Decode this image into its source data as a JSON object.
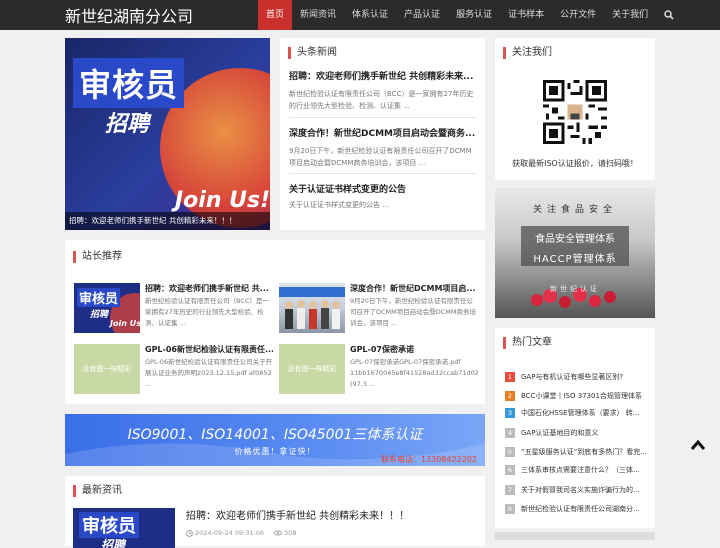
{
  "site": {
    "title": "新世纪湖南分公司"
  },
  "nav": {
    "items": [
      "首页",
      "新闻资讯",
      "体系认证",
      "产品认证",
      "服务认证",
      "证书样本",
      "公开文件",
      "关于我们"
    ],
    "active_index": 0,
    "search_icon": "search-icon"
  },
  "banner": {
    "headline": "审核员",
    "sub": "招聘",
    "join": "Join Us!",
    "caption": "招聘：欢迎老师们携手新世纪 共创精彩未来！！！"
  },
  "headlines": {
    "title": "头条新闻",
    "items": [
      {
        "title": "招聘：欢迎老师们携手新世纪 共创精彩未来...",
        "desc": "新世纪检验认证有限责任公司（BCC）是一家拥有27年历史的行业领先大型检验、检测、认证集 ..."
      },
      {
        "title": "深度合作！新世纪DCMM项目启动会暨商务...",
        "desc": "9月20日下午，新世纪检验认证有限责任公司召开了DCMM项目启动会暨DCMM商务培训会，该项目 ..."
      },
      {
        "title": "关于认证证书样式变更的公告",
        "desc": "关于认证证书样式变更的公告 ..."
      }
    ]
  },
  "follow": {
    "title": "关注我们",
    "caption": "获取最新ISO认证报价，请扫码哦！"
  },
  "food_ad": {
    "line1": "关注食品安全",
    "line2": "食品安全管理体系",
    "line3": "HACCP管理体系",
    "line4": "新世纪认证"
  },
  "hot": {
    "title": "热门文章",
    "items": [
      {
        "num": "1",
        "text": "GAP与有机认证有哪些显著区别?",
        "color": "#e74c3c"
      },
      {
        "num": "2",
        "text": "BCC小课堂丨ISO 37301合规管理体系",
        "color": "#e67e22"
      },
      {
        "num": "3",
        "text": "中国石化HSSE管理体系（要求） 转...",
        "color": "#3498db"
      },
      {
        "num": "4",
        "text": "GAP认证基地目的和意义",
        "color": "#bbbbbb"
      },
      {
        "num": "5",
        "text": "“五星级服务认证”到底有多热门？看完...",
        "color": "#bbbbbb"
      },
      {
        "num": "6",
        "text": "三体系审核点需要注意什么？（三体...",
        "color": "#bbbbbb"
      },
      {
        "num": "7",
        "text": "关于对假冒我司名义实施诈骗行为的...",
        "color": "#bbbbbb"
      },
      {
        "num": "8",
        "text": "新世纪检验认证有限责任公司湖南分...",
        "color": "#bbbbbb"
      }
    ]
  },
  "recommend": {
    "title": "站长推荐",
    "items": [
      {
        "title": "招聘：欢迎老师们携手新世纪 共...",
        "desc": "新世纪检验认证有限责任公司（BCC）是一家拥有27年历史的行业领先大型检验、检测、认证集 ...",
        "thumb": "recruit"
      },
      {
        "title": "深度合作！新世纪DCMM项目启...",
        "desc": "9月20日下午，新世纪检验认证有限责任公司召开了DCMM项目启动会暨DCMM商务培训会，该项目 ...",
        "thumb": "photo"
      },
      {
        "title": "GPL-06新世纪检验认证有限责任...",
        "desc": "GPL-06新世纪检验认证有限责任公司关于开展认证业务的声明2023.12.15.pdf af0852 ...",
        "thumb": "none"
      },
      {
        "title": "GPL-07保密承诺",
        "desc": "GPL-07保密承诺GPL-07保密承诺.pdf 11bb1670045e8f41528ad32ccab71d02.p (97.3 ...",
        "thumb": "none"
      }
    ],
    "no_image_text": "没有图一样精彩"
  },
  "iso_banner": {
    "line1": "ISO9001、ISO14001、ISO45001三体系认证",
    "line2": "价格优惠！拿证快！",
    "phone": "联系电话：13308422202"
  },
  "latest": {
    "title": "最新资讯",
    "item": {
      "title": "招聘：欢迎老师们携手新世纪 共创精彩未来！！！",
      "date": "2024-09-24 09:31:06",
      "views": "308",
      "thumb_a": "审核员",
      "thumb_b": "招聘"
    }
  },
  "colors": {
    "accent": "#c9302c",
    "topbar": "#2b2b2b"
  }
}
